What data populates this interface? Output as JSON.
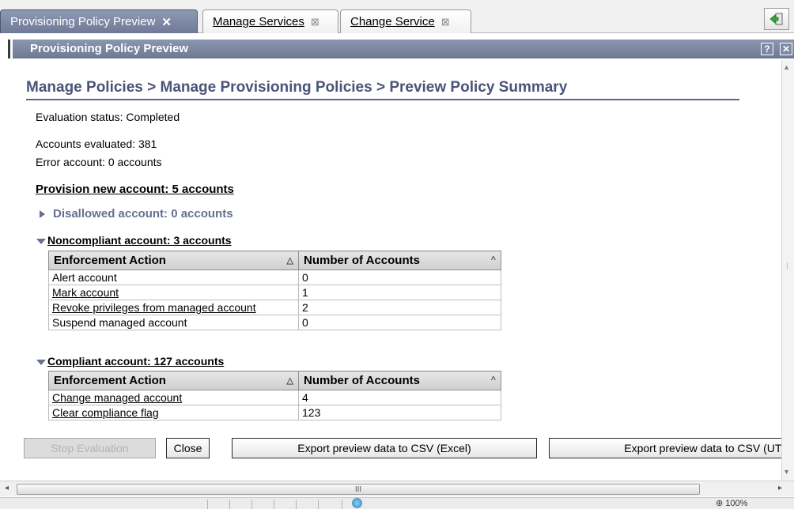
{
  "tabs": [
    {
      "label": "Provisioning Policy Preview",
      "close": "✕",
      "active": true
    },
    {
      "label": "Manage Services",
      "close": "⊠",
      "active": false
    },
    {
      "label": "Change Service",
      "close": "⊠",
      "active": false
    }
  ],
  "exit_icon": "exit-icon",
  "panel": {
    "title": "Provisioning Policy Preview",
    "help_icon_text": "?",
    "close_icon_text": "✕"
  },
  "breadcrumb": "Manage Policies > Manage Provisioning Policies > Preview Policy Summary",
  "summary": {
    "evaluation_status": "Evaluation status: Completed",
    "accounts_evaluated": "Accounts evaluated: 381",
    "error_account": "Error account: 0 accounts",
    "provision_new": "Provision new account: 5 accounts",
    "disallowed": "Disallowed account: 0 accounts"
  },
  "noncompliant": {
    "heading": "Noncompliant account: 3 accounts",
    "columns": [
      "Enforcement Action",
      "Number of Accounts"
    ],
    "rows": [
      {
        "action": "Alert account",
        "count": "0",
        "link": false
      },
      {
        "action": "Mark account",
        "count": "1",
        "link": true
      },
      {
        "action": "Revoke privileges from managed account",
        "count": "2",
        "link": true
      },
      {
        "action": "Suspend managed account",
        "count": "0",
        "link": false
      }
    ]
  },
  "compliant": {
    "heading": "Compliant account: 127 accounts",
    "columns": [
      "Enforcement Action",
      "Number of Accounts"
    ],
    "rows": [
      {
        "action": "Change managed account",
        "count": "4",
        "link": true
      },
      {
        "action": "Clear compliance flag",
        "count": "123",
        "link": true
      }
    ]
  },
  "buttons": {
    "stop": "Stop Evaluation",
    "close": "Close",
    "export_excel": "Export preview data to CSV (Excel)",
    "export_utf": "Export preview data to CSV (UTF"
  },
  "scrollbar": {
    "thumb_grip": "III"
  },
  "statusbar": {
    "zoom": "⊕ 100%"
  },
  "colors": {
    "accent": "#4a5478",
    "tab_active": "#7a85a3",
    "disabled_button": "#dcdcdc"
  }
}
